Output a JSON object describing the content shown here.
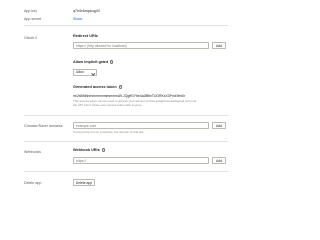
{
  "app_key": {
    "label": "App key",
    "value": "q7h4r4mqdcqy0l"
  },
  "app_secret": {
    "label": "App secret",
    "value": "Show"
  },
  "oauth2": {
    "label": "OAuth 2",
    "redirect_uris": {
      "title": "Redirect URIs",
      "placeholder": "https:// (http allowed for localhost)",
      "add_label": "Add"
    },
    "implicit_grant": {
      "title": "Allow implicit grant",
      "selected": "Allow"
    },
    "access_token": {
      "title": "Generated access token",
      "value": "rm2sBfdhhrhmmmmmmmmmA9-JQgffGYbe4a2f8tfvTUGRKsX3Pm49m0Ir",
      "help_line1": "This access token can be used to access your account (mhsa.jess@d.sensedigmail.com) via",
      "help_line2": "the API. Don't share your access token with anyone."
    }
  },
  "chooser_domains": {
    "label": "Chooser/Saver domains",
    "placeholder": "example.com",
    "add_label": "Add",
    "help": "If using Drop-ins on a website, the domain of that site."
  },
  "webhooks": {
    "label": "Webhooks",
    "title": "Webhook URIs",
    "placeholder": "https://",
    "add_label": "Add"
  },
  "delete_app": {
    "label": "Delete app",
    "button_label": "Delete app"
  },
  "colors": {
    "link": "#0061fe",
    "divider": "#e6e3df",
    "border": "#bdb9b3"
  }
}
